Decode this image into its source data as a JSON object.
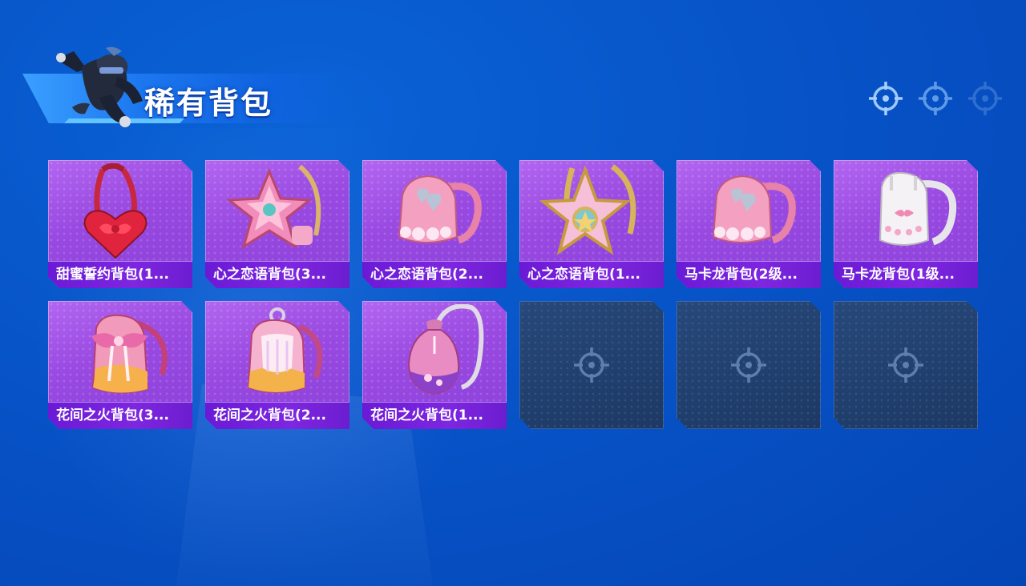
{
  "page": {
    "title": "稀有背包",
    "page_indicators": [
      {
        "state": "active"
      },
      {
        "state": "normal"
      },
      {
        "state": "dim"
      }
    ]
  },
  "colors": {
    "background": "#0754c8",
    "card_purple": "#9848e0",
    "label_bar": "#6a1ad6",
    "empty_slot": "#233f6c"
  },
  "items": [
    {
      "label": "甜蜜誓约背包(1...",
      "icon": "red-heart-bow-backpack-icon",
      "art": "heart"
    },
    {
      "label": "心之恋语背包(3...",
      "icon": "pink-star-backpack-icon",
      "art": "star"
    },
    {
      "label": "心之恋语背包(2...",
      "icon": "pink-heart-backpack-icon",
      "art": "pinkpack"
    },
    {
      "label": "心之恋语背包(1...",
      "icon": "gold-star-backpack-icon",
      "art": "goldstar"
    },
    {
      "label": "马卡龙背包(2级...",
      "icon": "pink-macaron-backpack-icon",
      "art": "pinkpack"
    },
    {
      "label": "马卡龙背包(1级...",
      "icon": "white-macaron-backpack-icon",
      "art": "whitepack"
    },
    {
      "label": "花间之火背包(3...",
      "icon": "floral-bow-backpack-icon",
      "art": "floral3"
    },
    {
      "label": "花间之火背包(2...",
      "icon": "floral-tassel-backpack-icon",
      "art": "floral2"
    },
    {
      "label": "花间之火背包(1...",
      "icon": "floral-pouch-backpack-icon",
      "art": "floral1"
    }
  ],
  "empty_slots": [
    {
      "icon": "crosshair-icon"
    },
    {
      "icon": "crosshair-icon"
    },
    {
      "icon": "crosshair-icon"
    }
  ]
}
